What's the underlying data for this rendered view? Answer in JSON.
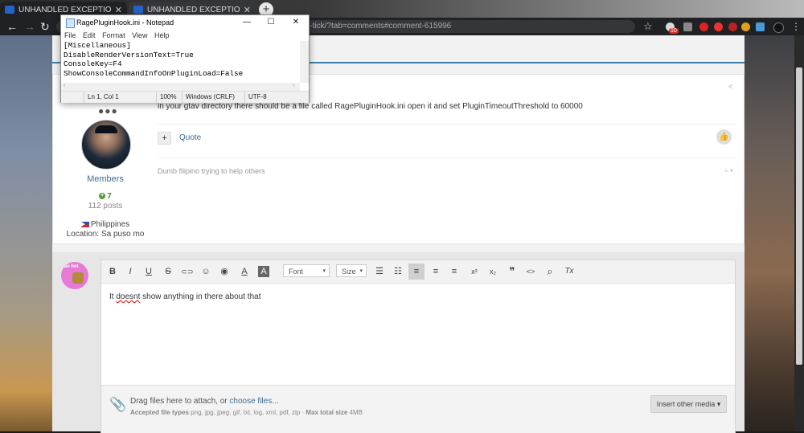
{
  "browser": {
    "tabs": [
      {
        "title": "UNHANDLED EXCEPTION DURING",
        "close": "✕",
        "active": true
      },
      {
        "title": "UNHANDLED EXCEPTION DURING",
        "close": "✕",
        "active": false
      }
    ],
    "new_tab": "+",
    "back": "←",
    "forward": "→",
    "reload": "↻",
    "url_visible": "r-tick/?tab=comments#comment-615996",
    "bookmark": "☆",
    "ext_badge": "10",
    "menu": "⋮"
  },
  "notepad": {
    "title": "RagePluginHook.ini - Notepad",
    "minimize": "—",
    "maximize": "☐",
    "close": "✕",
    "menu": [
      "File",
      "Edit",
      "Format",
      "View",
      "Help"
    ],
    "content": "[Miscellaneous]\nDisableRenderVersionText=True\nConsoleKey=F4\nShowConsoleCommandInfoOnPluginLoad=False",
    "scroll_left": "‹",
    "scroll_right": "›",
    "status": {
      "position": "Ln 1, Col 1",
      "zoom": "100%",
      "line_ending": "Windows (CRLF)",
      "encoding": "UTF-8"
    }
  },
  "post": {
    "online_indicator": "●●●",
    "group": "Members",
    "reputation": "7",
    "posts": "112 posts",
    "country": "Philippines",
    "location": "Location: Sa puso mo",
    "text": "in your gtav directory there should be a file called RagePluginHook.ini open it and set PluginTimeoutThreshold to 60000",
    "plus": "+",
    "quote": "Quote",
    "like": "👍",
    "share": "<",
    "signature": "Dumb filipino trying to help others",
    "sig_toggle": "≡ ▾"
  },
  "reply": {
    "avatar_text": "ae hot",
    "toolbar": {
      "bold": "B",
      "italic": "I",
      "underline": "U",
      "strike": "S",
      "link": "⊂⊃",
      "emoji": "☺",
      "spoiler": "◉",
      "text_color": "A",
      "bg_color": "A",
      "font": "Font",
      "size": "Size",
      "bullets": "☰",
      "numbered": "☷",
      "align_left": "≡",
      "align_center": "≡",
      "align_right": "≡",
      "superscript": "x²",
      "subscript": "x₂",
      "quote": "❞",
      "code": "<>",
      "search": "⌕",
      "clear": "Tx"
    },
    "body_pre": "It ",
    "body_misspelled": "doesnt",
    "body_post": " show anything in there about that",
    "attach": {
      "drag_text": "Drag files here to attach, or ",
      "choose_files": "choose files...",
      "accepted_label": "Accepted file types",
      "accepted_types": " png, jpg, jpeg, gif, txt, log, xml, pdf, zip · ",
      "max_label": "Max total size",
      "max_value": " 4MB",
      "insert_media": "Insert other media ▾"
    }
  },
  "colors": {
    "accent": "#3d6d96",
    "topline": "#3d7fa6",
    "online_green": "#5a9a3a"
  }
}
